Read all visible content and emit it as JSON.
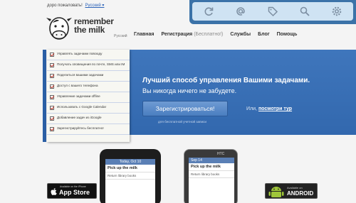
{
  "header": {
    "welcome": "доpo пожаловать!",
    "language": "Русский ▾"
  },
  "logo": {
    "line1": "remember",
    "line2": "the milk",
    "lang": "Русский"
  },
  "nav": {
    "home": "Главная",
    "register": "Регистрация",
    "register_note": "(Бесплатно!)",
    "services": "Службы",
    "blog": "Блог",
    "help": "Помощь"
  },
  "checklist": [
    "Управлять задачами повсюду",
    "Получать оповещения по почте, SMS или IM",
    "Поделиться вашими задачами",
    "Доступ с вашего телефона",
    "Управление задачами offline",
    "Использовать с Google Calendar",
    "Добавление задач из iGoogle",
    "Зарегистрируйтесь бесплатно!"
  ],
  "hero": {
    "title": "Лучший способ управления Вашими задачами.",
    "subtitle": "Вы никогда ничего не забудете.",
    "signup_button": "Зарегистрироваться!",
    "or": "Или,",
    "tour_link": "посмотри тур",
    "free_note": "для бесплатной учетной записи"
  },
  "iphone": {
    "date": "Today, Oct 10",
    "task1": "Pick up the milk",
    "task2": "Return library books"
  },
  "android_phone": {
    "brand": "HTC",
    "date": "Sep 14",
    "task1": "Pick up the milk",
    "task2": "Return library books"
  },
  "badges": {
    "appstore_small": "Available on the iPhone",
    "appstore_big": "App Store",
    "android_small": "Available on",
    "android_big": "ANDROID"
  },
  "icons": {
    "refresh": "refresh-icon",
    "at": "at-icon",
    "tag": "tag-icon",
    "search": "search-icon",
    "settings": "gear-icon"
  },
  "colors": {
    "hero_blue": "#3a6fb4",
    "link_blue": "#2b62b8",
    "phonebar_blue": "#3b72a8"
  }
}
